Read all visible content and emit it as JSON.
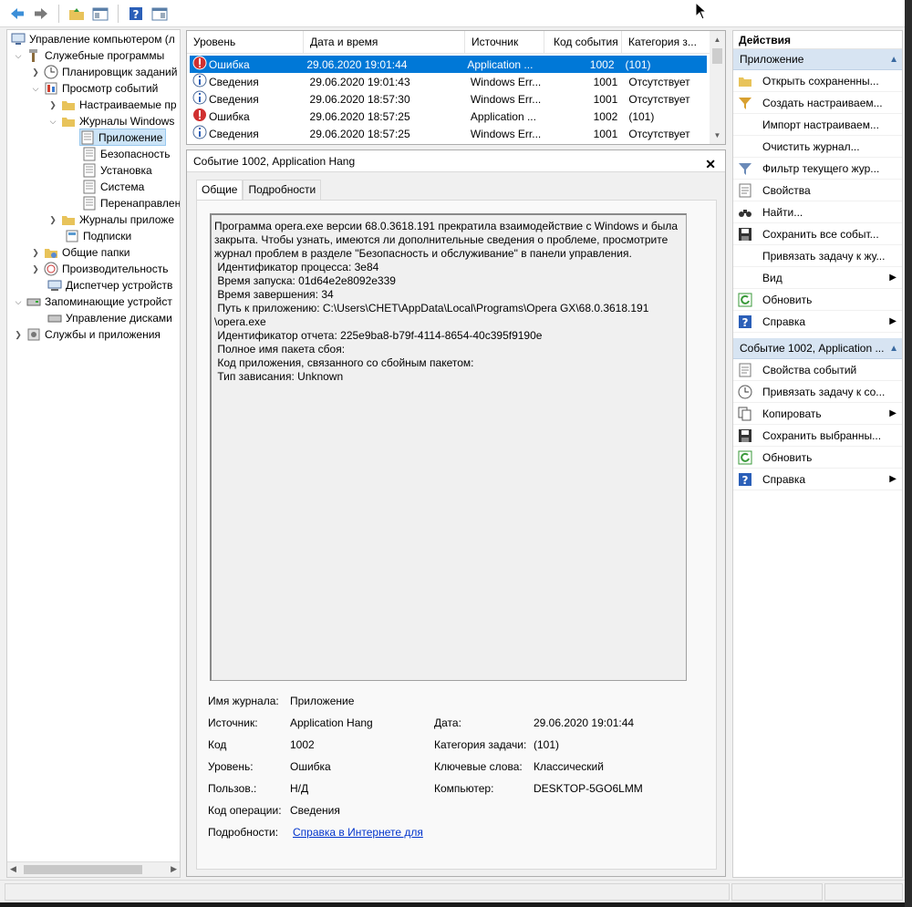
{
  "tree": {
    "items": [
      {
        "label": "Управление компьютером (л",
        "icon": "computer-mgmt-icon"
      },
      {
        "label": "Служебные программы",
        "icon": "tools-icon"
      },
      {
        "label": "Планировщик заданий",
        "icon": "clock-icon"
      },
      {
        "label": "Просмотр событий",
        "icon": "event-viewer-icon"
      },
      {
        "label": "Настраиваемые пр",
        "icon": "folder-icon"
      },
      {
        "label": "Журналы Windows",
        "icon": "folder-icon"
      },
      {
        "label": "Приложение",
        "icon": "log-icon"
      },
      {
        "label": "Безопасность",
        "icon": "log-icon"
      },
      {
        "label": "Установка",
        "icon": "log-icon"
      },
      {
        "label": "Система",
        "icon": "log-icon"
      },
      {
        "label": "Перенаправлен",
        "icon": "log-icon"
      },
      {
        "label": "Журналы приложе",
        "icon": "folder-icon"
      },
      {
        "label": "Подписки",
        "icon": "subscriptions-icon"
      },
      {
        "label": "Общие папки",
        "icon": "shared-folder-icon"
      },
      {
        "label": "Производительность",
        "icon": "performance-icon"
      },
      {
        "label": "Диспетчер устройств",
        "icon": "device-manager-icon"
      },
      {
        "label": "Запоминающие устройст",
        "icon": "storage-icon"
      },
      {
        "label": "Управление дисками",
        "icon": "disk-icon"
      },
      {
        "label": "Службы и приложения",
        "icon": "services-icon"
      }
    ]
  },
  "events": {
    "columns": [
      "Уровень",
      "Дата и время",
      "Источник",
      "Код события",
      "Категория з..."
    ],
    "rows": [
      {
        "level": "Ошибка",
        "date": "29.06.2020 19:01:44",
        "source": "Application ...",
        "code": "1002",
        "category": "(101)"
      },
      {
        "level": "Сведения",
        "date": "29.06.2020 19:01:43",
        "source": "Windows Err...",
        "code": "1001",
        "category": "Отсутствует"
      },
      {
        "level": "Сведения",
        "date": "29.06.2020 18:57:30",
        "source": "Windows Err...",
        "code": "1001",
        "category": "Отсутствует"
      },
      {
        "level": "Ошибка",
        "date": "29.06.2020 18:57:25",
        "source": "Application ...",
        "code": "1002",
        "category": "(101)"
      },
      {
        "level": "Сведения",
        "date": "29.06.2020 18:57:25",
        "source": "Windows Err...",
        "code": "1001",
        "category": "Отсутствует"
      }
    ]
  },
  "detail": {
    "title": "Событие 1002, Application Hang",
    "tab_general": "Общие",
    "tab_details": "Подробности",
    "description": "Программа opera.exe версии 68.0.3618.191 прекратила взаимодействие с Windows и была закрыта. Чтобы узнать, имеются ли дополнительные сведения о проблеме, просмотрите журнал проблем в разделе \"Безопасность и обслуживание\" в панели управления.\n Идентификатор процесса: 3e84\n Время запуска: 01d64e2e8092e339\n Время завершения: 34\n Путь к приложению: C:\\Users\\CHET\\AppData\\Local\\Programs\\Opera GX\\68.0.3618.191\n\\opera.exe\n Идентификатор отчета: 225e9ba8-b79f-4114-8654-40c395f9190e\n Полное имя пакета сбоя: \n Код приложения, связанного со сбойным пакетом: \n Тип зависания: Unknown",
    "props": {
      "log_name_label": "Имя журнала:",
      "log_name": "Приложение",
      "source_label": "Источник:",
      "source": "Application Hang",
      "date_label": "Дата:",
      "date": "29.06.2020 19:01:44",
      "code_label": "Код",
      "code": "1002",
      "task_label": "Категория задачи:",
      "task": "(101)",
      "level_label": "Уровень:",
      "level": "Ошибка",
      "keywords_label": "Ключевые слова:",
      "keywords": "Классический",
      "user_label": "Пользов.:",
      "user": "Н/Д",
      "computer_label": "Компьютер:",
      "computer": "DESKTOP-5GO6LMM",
      "opcode_label": "Код операции:",
      "opcode": "Сведения",
      "more_label": "Подробности:",
      "more_link": "Справка в Интернете для "
    }
  },
  "actions": {
    "header": "Действия",
    "section1": "Приложение",
    "items1": [
      {
        "label": "Открыть сохраненны...",
        "icon": "open-folder-icon"
      },
      {
        "label": "Создать настраиваем...",
        "icon": "filter-create-icon"
      },
      {
        "label": "Импорт настраиваем...",
        "icon": ""
      },
      {
        "label": "Очистить журнал...",
        "icon": ""
      },
      {
        "label": "Фильтр текущего жур...",
        "icon": "filter-icon"
      },
      {
        "label": "Свойства",
        "icon": "properties-icon"
      },
      {
        "label": "Найти...",
        "icon": "find-icon"
      },
      {
        "label": "Сохранить все событ...",
        "icon": "save-icon"
      },
      {
        "label": "Привязать задачу к жу...",
        "icon": ""
      },
      {
        "label": "Вид",
        "icon": "",
        "submenu": true
      },
      {
        "label": "Обновить",
        "icon": "refresh-icon"
      },
      {
        "label": "Справка",
        "icon": "help-icon",
        "submenu": true
      }
    ],
    "section2": "Событие 1002, Application ...",
    "items2": [
      {
        "label": "Свойства событий",
        "icon": "event-properties-icon"
      },
      {
        "label": "Привязать задачу к со...",
        "icon": "task-icon"
      },
      {
        "label": "Копировать",
        "icon": "copy-icon",
        "submenu": true
      },
      {
        "label": "Сохранить выбранны...",
        "icon": "save-icon"
      },
      {
        "label": "Обновить",
        "icon": "refresh-icon"
      },
      {
        "label": "Справка",
        "icon": "help-icon",
        "submenu": true
      }
    ]
  }
}
